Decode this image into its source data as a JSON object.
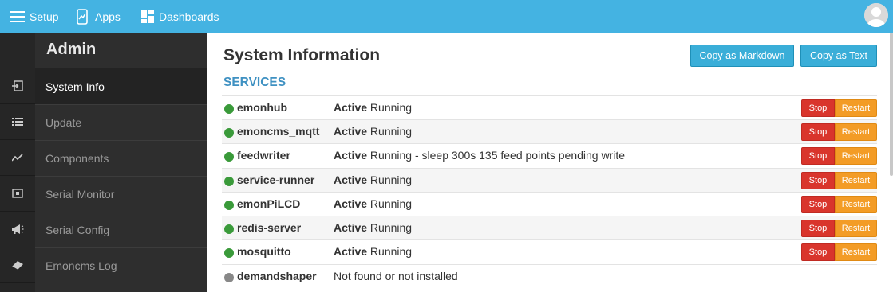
{
  "topbar": {
    "setup_label": "Setup",
    "apps_label": "Apps",
    "dashboards_label": "Dashboards",
    "setup_icon": "menu-icon",
    "apps_icon": "apps-icon",
    "dashboards_icon": "dashboard-grid-icon",
    "avatar_icon": "user-avatar-icon"
  },
  "rail": {
    "icons": [
      "login-icon",
      "list-icon",
      "graph-icon",
      "monitor-icon",
      "megaphone-icon",
      "eraser-icon"
    ]
  },
  "sidebar": {
    "title": "Admin",
    "items": [
      {
        "label": "System Info",
        "active": true
      },
      {
        "label": "Update",
        "active": false
      },
      {
        "label": "Components",
        "active": false
      },
      {
        "label": "Serial Monitor",
        "active": false
      },
      {
        "label": "Serial Config",
        "active": false
      },
      {
        "label": "Emoncms Log",
        "active": false
      }
    ]
  },
  "main": {
    "title": "System Information",
    "copy_markdown_label": "Copy as Markdown",
    "copy_text_label": "Copy as Text",
    "services_heading": "SERVICES",
    "stop_label": "Stop",
    "restart_label": "Restart",
    "services": [
      {
        "name": "emonhub",
        "state": "Active",
        "detail": "Running",
        "status": "ok"
      },
      {
        "name": "emoncms_mqtt",
        "state": "Active",
        "detail": "Running",
        "status": "ok"
      },
      {
        "name": "feedwriter",
        "state": "Active",
        "detail": "Running - sleep 300s 135 feed points pending write",
        "status": "ok"
      },
      {
        "name": "service-runner",
        "state": "Active",
        "detail": "Running",
        "status": "ok"
      },
      {
        "name": "emonPiLCD",
        "state": "Active",
        "detail": "Running",
        "status": "ok"
      },
      {
        "name": "redis-server",
        "state": "Active",
        "detail": "Running",
        "status": "ok"
      },
      {
        "name": "mosquitto",
        "state": "Active",
        "detail": "Running",
        "status": "ok"
      },
      {
        "name": "demandshaper",
        "state": "",
        "detail": "Not found or not installed",
        "status": "missing"
      }
    ]
  },
  "colors": {
    "topbar": "#44b3e2",
    "ok_dot": "#3a9a3a",
    "missing_dot": "#888888",
    "stop": "#d9352c",
    "restart": "#f39c26",
    "section_heading": "#3f91c2"
  }
}
